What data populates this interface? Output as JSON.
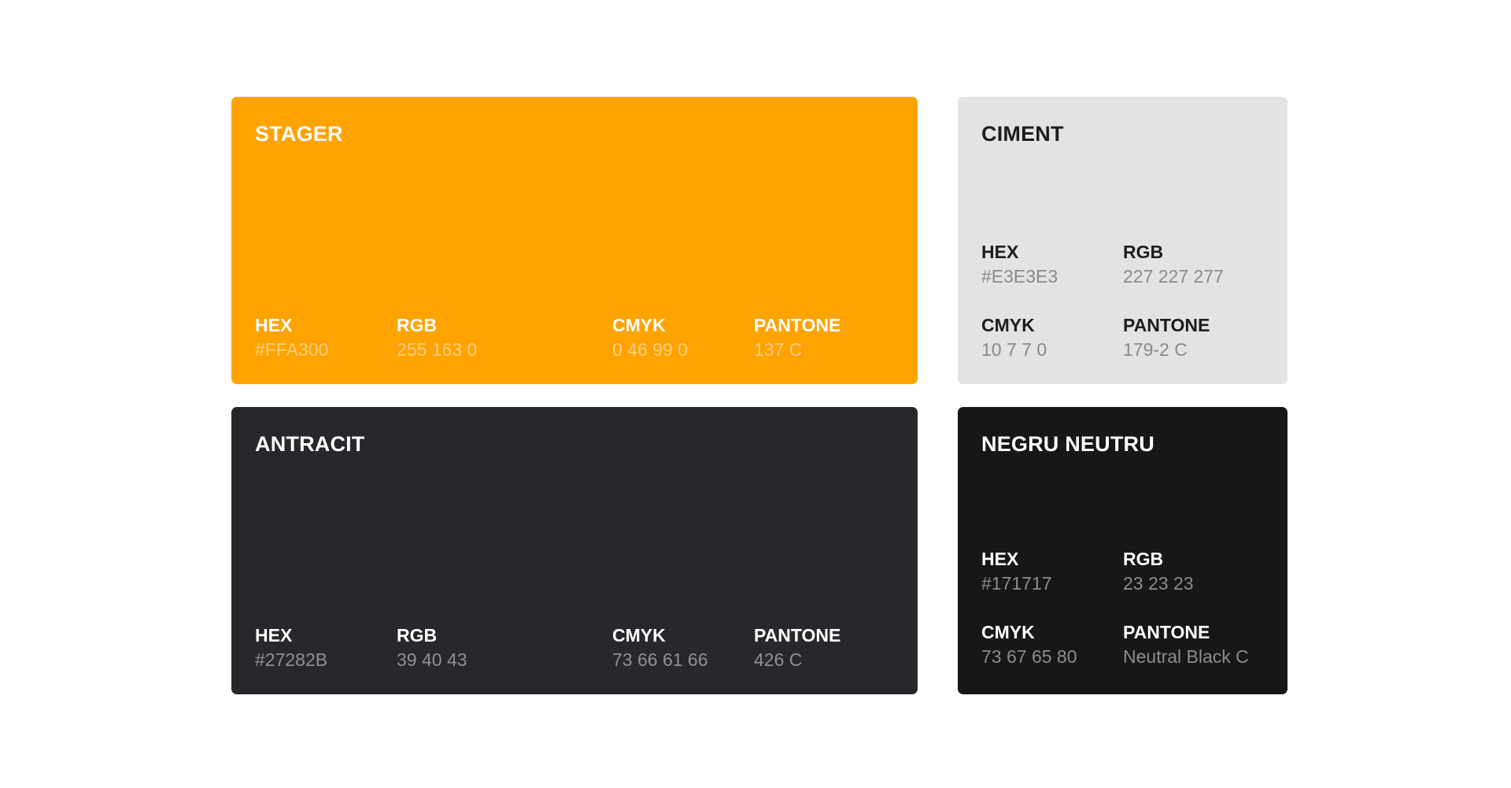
{
  "colors": [
    {
      "name": "STAGER",
      "swatch": "#FFA300",
      "hex_label": "HEX",
      "hex": "#FFA300",
      "rgb_label": "RGB",
      "rgb": "255 163 0",
      "cmyk_label": "CMYK",
      "cmyk": "0 46 99 0",
      "pantone_label": "PANTONE",
      "pantone": "137 C"
    },
    {
      "name": "CIMENT",
      "swatch": "#E3E3E3",
      "hex_label": "HEX",
      "hex": "#E3E3E3",
      "rgb_label": "RGB",
      "rgb": "227 227 277",
      "cmyk_label": "CMYK",
      "cmyk": "10 7 7 0",
      "pantone_label": "PANTONE",
      "pantone": "179-2 C"
    },
    {
      "name": "ANTRACIT",
      "swatch": "#27282B",
      "hex_label": "HEX",
      "hex": "#27282B",
      "rgb_label": "RGB",
      "rgb": "39 40 43",
      "cmyk_label": "CMYK",
      "cmyk": "73 66 61 66",
      "pantone_label": "PANTONE",
      "pantone": "426 C"
    },
    {
      "name": "NEGRU NEUTRU",
      "swatch": "#171717",
      "hex_label": "HEX",
      "hex": "#171717",
      "rgb_label": "RGB",
      "rgb": "23 23 23",
      "cmyk_label": "CMYK",
      "cmyk": "73 67 65 80",
      "pantone_label": "PANTONE",
      "pantone": "Neutral Black C"
    }
  ]
}
